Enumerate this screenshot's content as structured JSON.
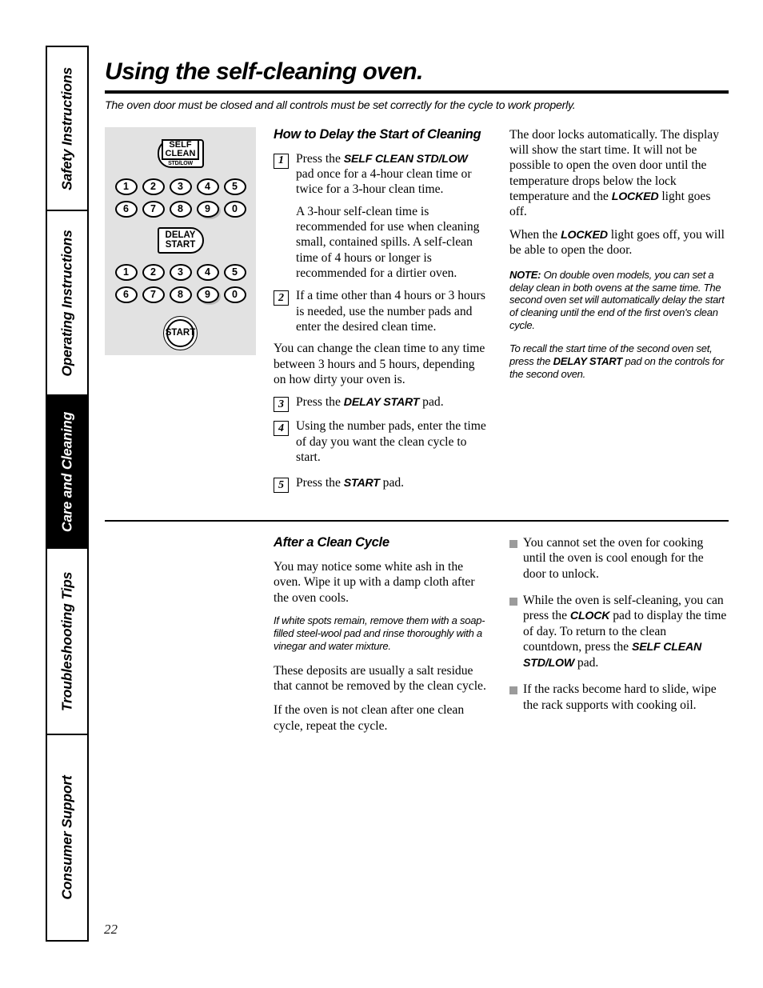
{
  "page": {
    "title": "Using the self-cleaning oven.",
    "subtitle": "The oven door must be closed and all controls must be set correctly for the cycle to work properly.",
    "number": "22"
  },
  "sidebar": {
    "tabs": [
      {
        "label": "Safety Instructions",
        "active": false
      },
      {
        "label": "Operating Instructions",
        "active": false
      },
      {
        "label": "Care and Cleaning",
        "active": true
      },
      {
        "label": "Troubleshooting Tips",
        "active": false
      },
      {
        "label": "Consumer Support",
        "active": false
      }
    ]
  },
  "control_panel": {
    "self_clean_line1": "SELF",
    "self_clean_line2": "CLEAN",
    "self_clean_sub": "STD/LOW",
    "delay_line1": "DELAY",
    "delay_line2": "START",
    "start_label": "START",
    "numpad_row1": [
      "1",
      "2",
      "3",
      "4",
      "5"
    ],
    "numpad_row2": [
      "6",
      "7",
      "8",
      "9",
      "0"
    ],
    "numpad_row3": [
      "1",
      "2",
      "3",
      "4",
      "5"
    ],
    "numpad_row4": [
      "6",
      "7",
      "8",
      "9",
      "0"
    ],
    "background_color": "#e2e2e2"
  },
  "delay_section": {
    "heading": "How to Delay the Start of Cleaning",
    "steps": [
      {
        "num": "1",
        "pre": "Press the ",
        "pad": "SELF CLEAN STD/LOW",
        "post": " pad once for a 4-hour clean time or twice for a 3-hour clean time.",
        "sub": "A 3-hour self-clean time is recommended for use when cleaning small, contained spills. A self-clean time of 4 hours or longer is recommended for a dirtier oven."
      },
      {
        "num": "2",
        "pre": "If a time other than 4 hours or 3 hours is needed, use the number pads and enter the desired clean time.",
        "pad": "",
        "post": "",
        "sub": ""
      },
      {
        "num": "3",
        "pre": "Press the ",
        "pad": "DELAY START",
        "post": " pad.",
        "sub": ""
      },
      {
        "num": "4",
        "pre": "Using the number pads, enter the time of day you want the clean cycle to start.",
        "pad": "",
        "post": "",
        "sub": ""
      },
      {
        "num": "5",
        "pre": "Press the ",
        "pad": "START",
        "post": " pad.",
        "sub": ""
      }
    ],
    "interstitial": "You can change the clean time to any time between 3 hours and 5 hours, depending on how dirty your oven is."
  },
  "delay_right": {
    "para1_a": "The door locks automatically. The display will show the start time. It will not be possible to open the oven door until the temperature drops below the lock temperature and the ",
    "para1_pad": "LOCKED",
    "para1_b": " light goes off.",
    "para2_a": "When the ",
    "para2_pad": "LOCKED",
    "para2_b": " light goes off, you will be able to open the door.",
    "note_label": "NOTE:",
    "note_text": " On double oven models, you can set a delay clean in both ovens at the same time. The second oven set will automatically delay the start of cleaning until the end of the first oven's clean cycle.",
    "recall_a": "To recall the start time of the second oven set, press the ",
    "recall_pad": "DELAY START",
    "recall_b": " pad on the controls for the second oven."
  },
  "after_section": {
    "heading": "After a Clean Cycle",
    "para1": "You may notice some white ash in the oven. Wipe it up with a damp cloth after the oven cools.",
    "italic_note": "If white spots remain, remove them with a soap-filled steel-wool pad and rinse thoroughly with a vinegar and water mixture.",
    "para2": "These deposits are usually a salt residue that cannot be removed by the clean cycle.",
    "para3": "If the oven is not clean after one clean cycle, repeat the cycle."
  },
  "after_bullets": [
    {
      "a": "You cannot set the oven for cooking until the oven is cool enough for the door to unlock.",
      "pad1": "",
      "b": "",
      "pad2": "",
      "c": ""
    },
    {
      "a": "While the oven is self-cleaning, you can press the ",
      "pad1": "CLOCK",
      "b": " pad to display the time of day. To return to the clean countdown, press the ",
      "pad2": "SELF CLEAN STD/LOW",
      "c": " pad."
    },
    {
      "a": "If the racks become hard to slide, wipe the rack supports with cooking oil.",
      "pad1": "",
      "b": "",
      "pad2": "",
      "c": ""
    }
  ]
}
